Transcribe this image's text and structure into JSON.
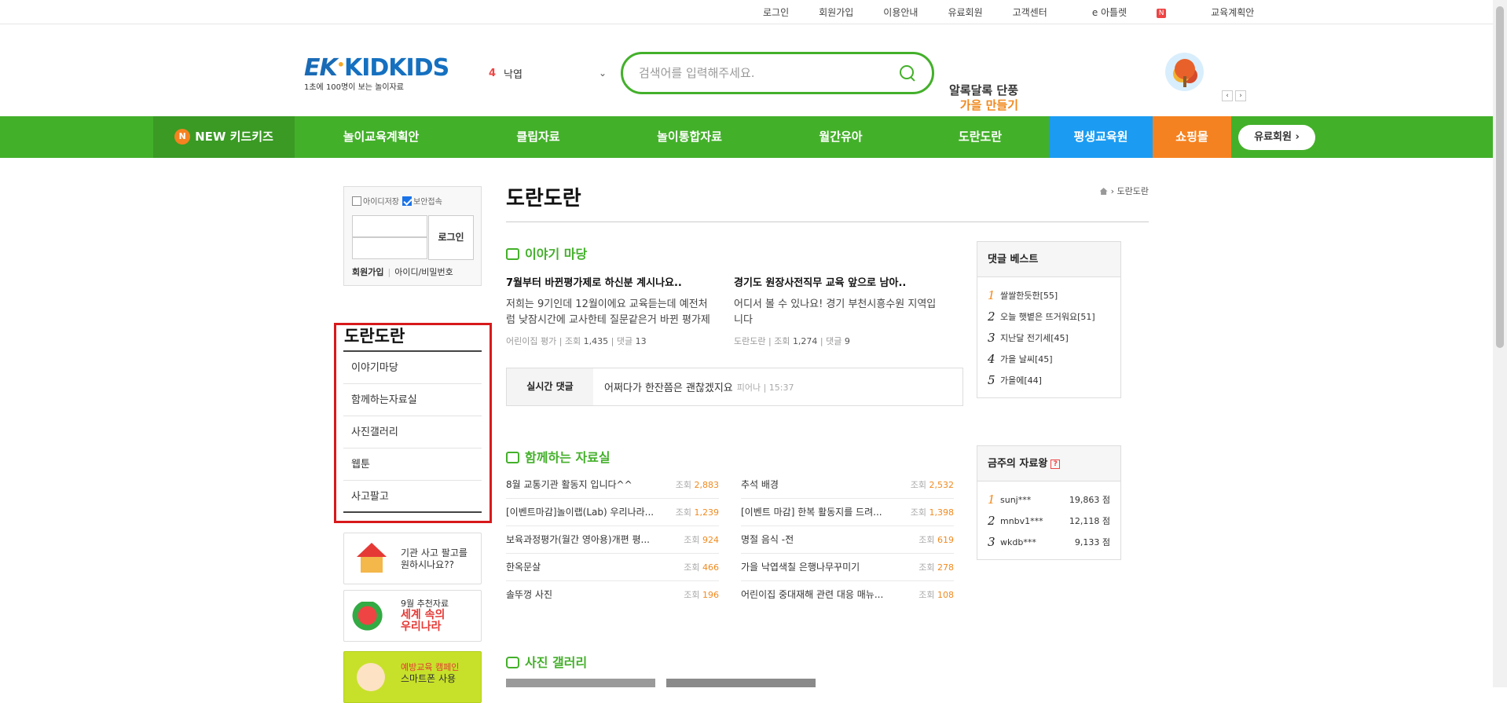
{
  "topbar": {
    "links": [
      "로그인",
      "회원가입",
      "이용안내",
      "유료회원",
      "고객센터",
      "e 아틀렛",
      "교육계획안"
    ],
    "badge": "N"
  },
  "header": {
    "logo_ek": "EK",
    "logo_kid": "KIDKIDS",
    "logo_tagline": "1초에 100명이 보는 놀이자료",
    "location_num": "4",
    "location_label": "낙엽",
    "search_placeholder": "검색어를 입력해주세요.",
    "promo_line1": "알록달록 단풍",
    "promo_line2": "가을 만들기"
  },
  "gnb": {
    "new_badge": "N",
    "new_label": "NEW 키드키즈",
    "items": [
      "놀이교육계획안",
      "클립자료",
      "놀이통합자료",
      "월간유아",
      "도란도란"
    ],
    "edu": "평생교육원",
    "shop": "쇼핑몰",
    "paid": "유료회원 ›"
  },
  "login": {
    "save_id": "아이디저장",
    "secure": "보안접속",
    "button": "로그인",
    "join": "회원가입",
    "find": "아이디/비밀번호"
  },
  "sidemenu": {
    "title": "도란도란",
    "items": [
      "이야기마당",
      "함께하는자료실",
      "사진갤러리",
      "웹툰",
      "사고팔고"
    ]
  },
  "banners": {
    "b1_line1": "기관 사고 팔고를",
    "b1_line2": "원하시나요??",
    "b2_line1": "9월 추천자료",
    "b2_line2": "세계 속의",
    "b2_line3": "우리나라",
    "b3_line1": "예방교육 캠페인",
    "b3_line2": "스마트폰 사용"
  },
  "main": {
    "title": "도란도란",
    "breadcrumb": "도란도란",
    "story_section": "이야기 마당",
    "stories": [
      {
        "title": "7월부터 바뀐평가제로 하신분 계시나요..",
        "body": "저희는 9기인데 12월이에요 교육듣는데 예전처럼 낮잠시간에 교사한테 질문같은거 바뀐 평가제",
        "board": "어린이집 평가",
        "views_label": "조회",
        "views": "1,435",
        "comments_label": "댓글",
        "comments": "13"
      },
      {
        "title": "경기도 원장사전직무 교육 앞으로 남아..",
        "body": "어디서 볼 수 있나요! 경기 부천시흥수원 지역입니다",
        "board": "도란도란",
        "views_label": "조회",
        "views": "1,274",
        "comments_label": "댓글",
        "comments": "9"
      }
    ],
    "realtime_label": "실시간 댓글",
    "realtime_text": "어쩌다가 한잔쯤은 괜찮겠지요",
    "realtime_meta": "피어나 | 15:37",
    "library_section": "함께하는 자료실",
    "library_left": [
      {
        "title": "8월 교통기관 활동지 입니다^^",
        "label": "조회",
        "views": "2,883"
      },
      {
        "title": "[이벤트마감]놀이랩(Lab) 우리나라...",
        "label": "조회",
        "views": "1,239"
      },
      {
        "title": "보육과정평가(월간 영아용)개편 평...",
        "label": "조회",
        "views": "924"
      },
      {
        "title": "한옥문살",
        "label": "조회",
        "views": "466"
      },
      {
        "title": "솔뚜껑 사진",
        "label": "조회",
        "views": "196"
      }
    ],
    "library_right": [
      {
        "title": "추석 배경",
        "label": "조회",
        "views": "2,532"
      },
      {
        "title": "[이벤트 마감] 한복 활동지를 드려...",
        "label": "조회",
        "views": "1,398"
      },
      {
        "title": "명절 음식 -전",
        "label": "조회",
        "views": "619"
      },
      {
        "title": "가을 낙엽색칠 은행나무꾸미기",
        "label": "조회",
        "views": "278"
      },
      {
        "title": "어린이집 중대재해 관련 대응 매뉴...",
        "label": "조회",
        "views": "108"
      }
    ],
    "gallery_section": "사진 갤러리"
  },
  "best": {
    "title": "댓글 베스트",
    "items": [
      {
        "rank": "1",
        "text": "쌀쌀한듯한[55]"
      },
      {
        "rank": "2",
        "text": "오늘 햇볕은 뜨거워요[51]"
      },
      {
        "rank": "3",
        "text": "지난달 전기세[45]"
      },
      {
        "rank": "4",
        "text": "가을 날씨[45]"
      },
      {
        "rank": "5",
        "text": "가을에[44]"
      }
    ]
  },
  "king": {
    "title": "금주의 자료왕",
    "help": "?",
    "items": [
      {
        "rank": "1",
        "user": "sunj***",
        "score": "19,863 점"
      },
      {
        "rank": "2",
        "user": "mnbv1***",
        "score": "12,118 점"
      },
      {
        "rank": "3",
        "user": "wkdb***",
        "score": "9,133 점"
      }
    ]
  }
}
